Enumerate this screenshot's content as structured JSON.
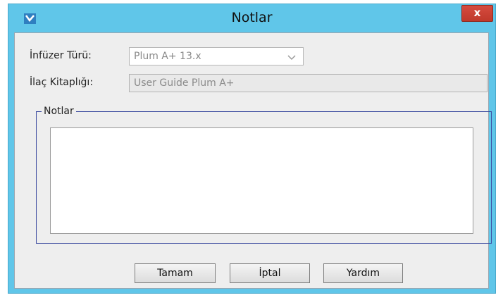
{
  "window": {
    "title": "Notlar",
    "close_label": "x"
  },
  "form": {
    "infuser_type_label": "İnfüzer Türü:",
    "infuser_type_value": "Plum A+ 13.x",
    "drug_library_label": "İlaç Kitaplığı:",
    "drug_library_value": "User Guide Plum A+",
    "notes_group_label": "Notlar",
    "notes_value": ""
  },
  "buttons": {
    "ok_label": "Tamam",
    "cancel_label": "İptal",
    "help_label": "Yardım"
  },
  "colors": {
    "titlebar": "#60c6e9",
    "close_button": "#c9433a",
    "group_border": "#3b4a9f"
  },
  "icons": {
    "app": "app-checkmark-icon",
    "close": "close-icon",
    "dropdown": "chevron-down-icon"
  }
}
